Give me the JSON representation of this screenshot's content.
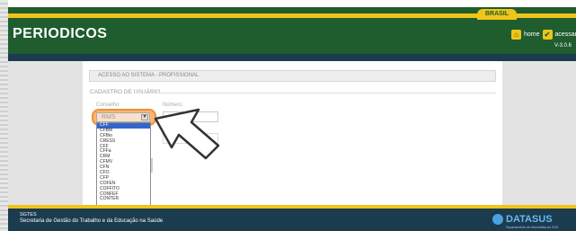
{
  "header": {
    "brasil_tab": "BRASIL",
    "title": "PERIODICOS",
    "nav_home": "home",
    "nav_acessar": "acessar",
    "version": "V-3.0.6"
  },
  "form": {
    "section_title": "ACESSO AO SISTEMA - PROFISSIONAL",
    "fieldset_legend": "CADASTRO DE USUÁRIO",
    "conselho_label": "Conselho:",
    "numero_label": "Número:",
    "conselho_selected": "RMS",
    "conselho_options": [
      "CFF",
      "CFBM",
      "CFBio",
      "CRESS",
      "CFF",
      "CFFa",
      "CRM",
      "CFMV",
      "CFN",
      "CFO",
      "CFP",
      "COFEN",
      "COFFITO",
      "CONFEF",
      "CONTER"
    ],
    "selected_index": 0
  },
  "footer": {
    "org": "SGTES",
    "dept": "Secretaria de Gestão do Trabalho e da Educação na Saúde",
    "brand": "DATASUS",
    "brand_sub": "Departamento de Informática do SUS"
  },
  "colors": {
    "header_green": "#1f5c2e",
    "accent_yellow": "#f0c419",
    "footer_blue": "#1b3b4f",
    "highlight_orange": "#ef9138"
  }
}
